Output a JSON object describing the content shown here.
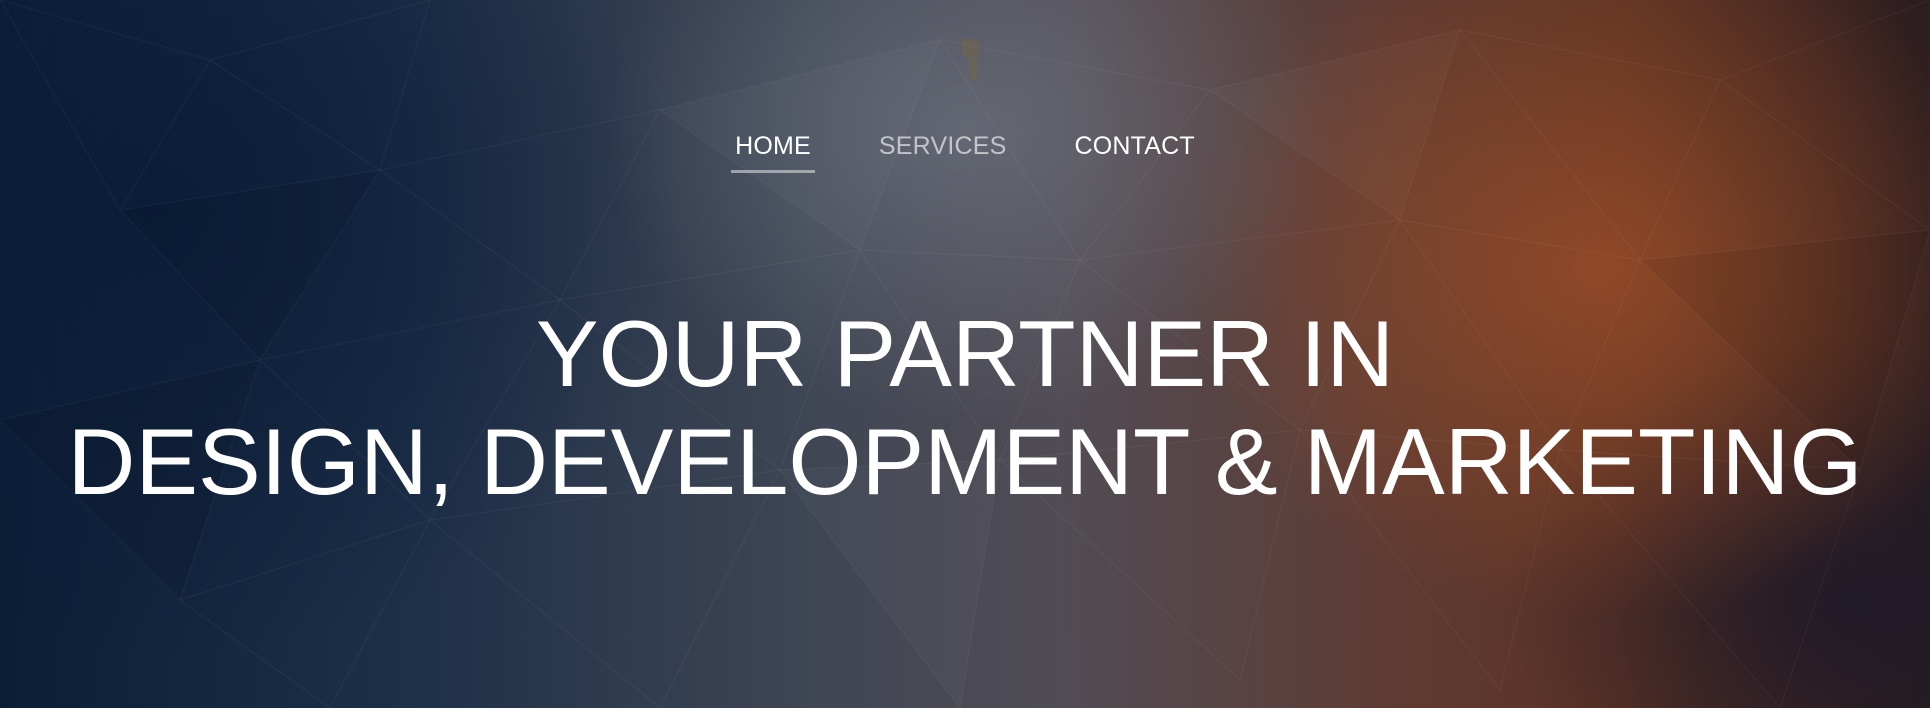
{
  "nav": {
    "items": [
      {
        "label": "HOME",
        "state": "active"
      },
      {
        "label": "SERVICES",
        "state": "dim"
      },
      {
        "label": "CONTACT",
        "state": "normal"
      }
    ]
  },
  "hero": {
    "line1": "YOUR PARTNER IN",
    "line2": "DESIGN, DEVELOPMENT & MARKETING"
  },
  "colors": {
    "left_navy": "#0c1d36",
    "center_gray": "#514c55",
    "right_rust": "#5b3224",
    "text": "#ffffff",
    "nav_underline": "#c8c8cd"
  },
  "icons": {
    "logo": "logo-mark-icon"
  }
}
